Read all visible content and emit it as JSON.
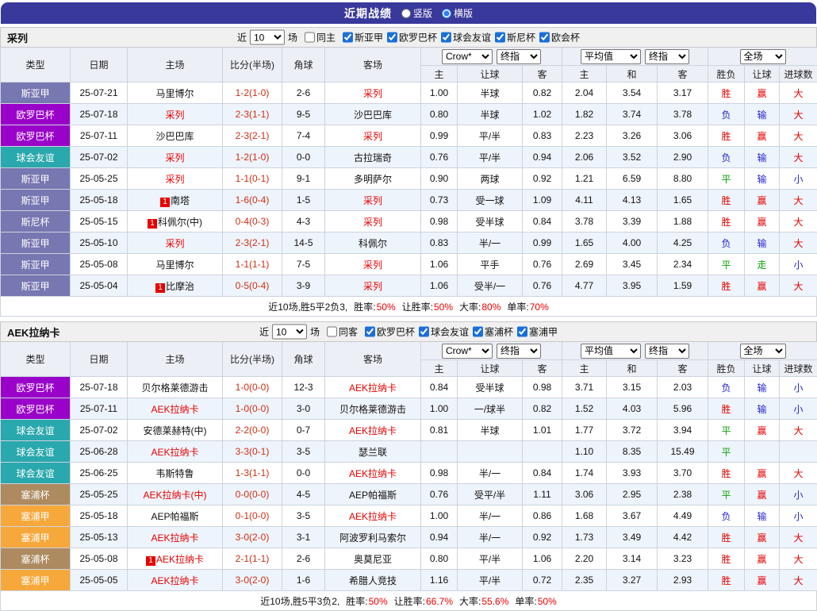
{
  "topbar": {
    "title": "近期战绩",
    "radios": [
      {
        "label": "竖版",
        "selected": false
      },
      {
        "label": "横版",
        "selected": true
      }
    ]
  },
  "league_colors": {
    "斯亚甲": "#7777b2",
    "斯尼杯": "#7777b2",
    "欧罗巴杯": "#9902c9",
    "球会友谊": "#29a8ad",
    "塞浦杯": "#ad8a60",
    "塞浦甲": "#f7a83b"
  },
  "sections": [
    {
      "title": "采列",
      "filters": {
        "near_label": "近",
        "count": "10",
        "games_label": "场",
        "same_label": "同主",
        "same_checked": false,
        "leagues": [
          {
            "label": "斯亚甲",
            "checked": true
          },
          {
            "label": "欧罗巴杯",
            "checked": true
          },
          {
            "label": "球会友谊",
            "checked": true
          },
          {
            "label": "斯尼杯",
            "checked": true
          },
          {
            "label": "欧会杯",
            "checked": true
          }
        ]
      },
      "header": {
        "cols": [
          "类型",
          "日期",
          "主场",
          "比分(半场)",
          "角球",
          "客场"
        ],
        "sub": [
          "主",
          "让球",
          "客",
          "主",
          "和",
          "客",
          "胜负",
          "让球",
          "进球数"
        ],
        "group1_selects": [
          "Crow*",
          "终指"
        ],
        "group2_selects": [
          "平均值",
          "终指"
        ],
        "group3_select": "全场"
      },
      "rows": [
        {
          "league": "斯亚甲",
          "date": "25-07-21",
          "home": {
            "name": "马里博尔",
            "red": false,
            "badge": ""
          },
          "score": "1-2(1-0)",
          "corner": "2-6",
          "away": {
            "name": "采列",
            "red": true,
            "badge": ""
          },
          "odds": [
            "1.00",
            "半球",
            "0.82"
          ],
          "avg": [
            "2.04",
            "3.54",
            "3.17"
          ],
          "results": [
            {
              "t": "胜",
              "c": "red"
            },
            {
              "t": "赢",
              "c": "red"
            },
            {
              "t": "大",
              "c": "red"
            }
          ]
        },
        {
          "league": "欧罗巴杯",
          "date": "25-07-18",
          "home": {
            "name": "采列",
            "red": true,
            "badge": ""
          },
          "score": "2-3(1-1)",
          "corner": "9-5",
          "away": {
            "name": "沙巴巴库",
            "red": false,
            "badge": ""
          },
          "odds": [
            "0.80",
            "半球",
            "1.02"
          ],
          "avg": [
            "1.82",
            "3.74",
            "3.78"
          ],
          "results": [
            {
              "t": "负",
              "c": "blue"
            },
            {
              "t": "输",
              "c": "blue"
            },
            {
              "t": "大",
              "c": "red"
            }
          ]
        },
        {
          "league": "欧罗巴杯",
          "date": "25-07-11",
          "home": {
            "name": "沙巴巴库",
            "red": false,
            "badge": ""
          },
          "score": "2-3(2-1)",
          "corner": "7-4",
          "away": {
            "name": "采列",
            "red": true,
            "badge": ""
          },
          "odds": [
            "0.99",
            "平/半",
            "0.83"
          ],
          "avg": [
            "2.23",
            "3.26",
            "3.06"
          ],
          "results": [
            {
              "t": "胜",
              "c": "red"
            },
            {
              "t": "赢",
              "c": "red"
            },
            {
              "t": "大",
              "c": "red"
            }
          ]
        },
        {
          "league": "球会友谊",
          "date": "25-07-02",
          "home": {
            "name": "采列",
            "red": true,
            "badge": ""
          },
          "score": "1-2(1-0)",
          "corner": "0-0",
          "away": {
            "name": "古拉瑞奇",
            "red": false,
            "badge": ""
          },
          "odds": [
            "0.76",
            "平/半",
            "0.94"
          ],
          "avg": [
            "2.06",
            "3.52",
            "2.90"
          ],
          "results": [
            {
              "t": "负",
              "c": "blue"
            },
            {
              "t": "输",
              "c": "blue"
            },
            {
              "t": "大",
              "c": "red"
            }
          ]
        },
        {
          "league": "斯亚甲",
          "date": "25-05-25",
          "home": {
            "name": "采列",
            "red": true,
            "badge": ""
          },
          "score": "1-1(0-1)",
          "corner": "9-1",
          "away": {
            "name": "多明萨尔",
            "red": false,
            "badge": ""
          },
          "odds": [
            "0.90",
            "两球",
            "0.92"
          ],
          "avg": [
            "1.21",
            "6.59",
            "8.80"
          ],
          "results": [
            {
              "t": "平",
              "c": "green"
            },
            {
              "t": "输",
              "c": "blue"
            },
            {
              "t": "小",
              "c": "blue"
            }
          ]
        },
        {
          "league": "斯亚甲",
          "date": "25-05-18",
          "home": {
            "name": "南塔",
            "red": false,
            "badge": "1"
          },
          "score": "1-6(0-4)",
          "corner": "1-5",
          "away": {
            "name": "采列",
            "red": true,
            "badge": ""
          },
          "odds": [
            "0.73",
            "受一球",
            "1.09"
          ],
          "avg": [
            "4.11",
            "4.13",
            "1.65"
          ],
          "results": [
            {
              "t": "胜",
              "c": "red"
            },
            {
              "t": "赢",
              "c": "red"
            },
            {
              "t": "大",
              "c": "red"
            }
          ]
        },
        {
          "league": "斯尼杯",
          "date": "25-05-15",
          "home": {
            "name": "科佩尔(中)",
            "red": false,
            "badge": "1"
          },
          "score": "0-4(0-3)",
          "corner": "4-3",
          "away": {
            "name": "采列",
            "red": true,
            "badge": ""
          },
          "odds": [
            "0.98",
            "受半球",
            "0.84"
          ],
          "avg": [
            "3.78",
            "3.39",
            "1.88"
          ],
          "results": [
            {
              "t": "胜",
              "c": "red"
            },
            {
              "t": "赢",
              "c": "red"
            },
            {
              "t": "大",
              "c": "red"
            }
          ]
        },
        {
          "league": "斯亚甲",
          "date": "25-05-10",
          "home": {
            "name": "采列",
            "red": true,
            "badge": ""
          },
          "score": "2-3(2-1)",
          "corner": "14-5",
          "away": {
            "name": "科佩尔",
            "red": false,
            "badge": ""
          },
          "odds": [
            "0.83",
            "半/一",
            "0.99"
          ],
          "avg": [
            "1.65",
            "4.00",
            "4.25"
          ],
          "results": [
            {
              "t": "负",
              "c": "blue"
            },
            {
              "t": "输",
              "c": "blue"
            },
            {
              "t": "大",
              "c": "red"
            }
          ]
        },
        {
          "league": "斯亚甲",
          "date": "25-05-08",
          "home": {
            "name": "马里博尔",
            "red": false,
            "badge": ""
          },
          "score": "1-1(1-1)",
          "corner": "7-5",
          "away": {
            "name": "采列",
            "red": true,
            "badge": ""
          },
          "odds": [
            "1.06",
            "平手",
            "0.76"
          ],
          "avg": [
            "2.69",
            "3.45",
            "2.34"
          ],
          "results": [
            {
              "t": "平",
              "c": "green"
            },
            {
              "t": "走",
              "c": "green"
            },
            {
              "t": "小",
              "c": "blue"
            }
          ]
        },
        {
          "league": "斯亚甲",
          "date": "25-05-04",
          "home": {
            "name": "比摩治",
            "red": false,
            "badge": "1"
          },
          "score": "0-5(0-4)",
          "corner": "3-9",
          "away": {
            "name": "采列",
            "red": true,
            "badge": ""
          },
          "odds": [
            "1.06",
            "受半/一",
            "0.76"
          ],
          "avg": [
            "4.77",
            "3.95",
            "1.59"
          ],
          "results": [
            {
              "t": "胜",
              "c": "red"
            },
            {
              "t": "赢",
              "c": "red"
            },
            {
              "t": "大",
              "c": "red"
            }
          ]
        }
      ],
      "summary": {
        "prefix": "近10场,胜5平2负3,",
        "stats": [
          {
            "label": "胜率:",
            "value": "50%"
          },
          {
            "label": "让胜率:",
            "value": "50%"
          },
          {
            "label": "大率:",
            "value": "80%"
          },
          {
            "label": "单率:",
            "value": "70%"
          }
        ]
      }
    },
    {
      "title": "AEK拉纳卡",
      "filters": {
        "near_label": "近",
        "count": "10",
        "games_label": "场",
        "same_label": "同客",
        "same_checked": false,
        "leagues": [
          {
            "label": "欧罗巴杯",
            "checked": true
          },
          {
            "label": "球会友谊",
            "checked": true
          },
          {
            "label": "塞浦杯",
            "checked": true
          },
          {
            "label": "塞浦甲",
            "checked": true
          }
        ]
      },
      "header": {
        "cols": [
          "类型",
          "日期",
          "主场",
          "比分(半场)",
          "角球",
          "客场"
        ],
        "sub": [
          "主",
          "让球",
          "客",
          "主",
          "和",
          "客",
          "胜负",
          "让球",
          "进球数"
        ],
        "group1_selects": [
          "Crow*",
          "终指"
        ],
        "group2_selects": [
          "平均值",
          "终指"
        ],
        "group3_select": "全场"
      },
      "rows": [
        {
          "league": "欧罗巴杯",
          "date": "25-07-18",
          "home": {
            "name": "贝尔格莱德游击",
            "red": false,
            "badge": ""
          },
          "score": "1-0(0-0)",
          "corner": "12-3",
          "away": {
            "name": "AEK拉纳卡",
            "red": true,
            "badge": ""
          },
          "odds": [
            "0.84",
            "受半球",
            "0.98"
          ],
          "avg": [
            "3.71",
            "3.15",
            "2.03"
          ],
          "results": [
            {
              "t": "负",
              "c": "blue"
            },
            {
              "t": "输",
              "c": "blue"
            },
            {
              "t": "小",
              "c": "blue"
            }
          ]
        },
        {
          "league": "欧罗巴杯",
          "date": "25-07-11",
          "home": {
            "name": "AEK拉纳卡",
            "red": true,
            "badge": ""
          },
          "score": "1-0(0-0)",
          "corner": "3-0",
          "away": {
            "name": "贝尔格莱德游击",
            "red": false,
            "badge": ""
          },
          "odds": [
            "1.00",
            "一/球半",
            "0.82"
          ],
          "avg": [
            "1.52",
            "4.03",
            "5.96"
          ],
          "results": [
            {
              "t": "胜",
              "c": "red"
            },
            {
              "t": "输",
              "c": "blue"
            },
            {
              "t": "小",
              "c": "blue"
            }
          ]
        },
        {
          "league": "球会友谊",
          "date": "25-07-02",
          "home": {
            "name": "安德莱赫特(中)",
            "red": false,
            "badge": ""
          },
          "score": "2-2(0-0)",
          "corner": "0-7",
          "away": {
            "name": "AEK拉纳卡",
            "red": true,
            "badge": ""
          },
          "odds": [
            "0.81",
            "半球",
            "1.01"
          ],
          "avg": [
            "1.77",
            "3.72",
            "3.94"
          ],
          "results": [
            {
              "t": "平",
              "c": "green"
            },
            {
              "t": "赢",
              "c": "red"
            },
            {
              "t": "大",
              "c": "red"
            }
          ]
        },
        {
          "league": "球会友谊",
          "date": "25-06-28",
          "home": {
            "name": "AEK拉纳卡",
            "red": true,
            "badge": ""
          },
          "score": "3-3(0-1)",
          "corner": "3-5",
          "away": {
            "name": "瑟兰联",
            "red": false,
            "badge": ""
          },
          "odds": [
            "",
            "",
            ""
          ],
          "avg": [
            "1.10",
            "8.35",
            "15.49"
          ],
          "results": [
            {
              "t": "平",
              "c": "green"
            },
            {
              "t": "",
              "c": "none"
            },
            {
              "t": "",
              "c": "none"
            }
          ]
        },
        {
          "league": "球会友谊",
          "date": "25-06-25",
          "home": {
            "name": "韦斯特鲁",
            "red": false,
            "badge": ""
          },
          "score": "1-3(1-1)",
          "corner": "0-0",
          "away": {
            "name": "AEK拉纳卡",
            "red": true,
            "badge": ""
          },
          "odds": [
            "0.98",
            "半/一",
            "0.84"
          ],
          "avg": [
            "1.74",
            "3.93",
            "3.70"
          ],
          "results": [
            {
              "t": "胜",
              "c": "red"
            },
            {
              "t": "赢",
              "c": "red"
            },
            {
              "t": "大",
              "c": "red"
            }
          ]
        },
        {
          "league": "塞浦杯",
          "date": "25-05-25",
          "home": {
            "name": "AEK拉纳卡(中)",
            "red": true,
            "badge": ""
          },
          "score": "0-0(0-0)",
          "corner": "4-5",
          "away": {
            "name": "AEP帕福斯",
            "red": false,
            "badge": ""
          },
          "odds": [
            "0.76",
            "受平/半",
            "1.11"
          ],
          "avg": [
            "3.06",
            "2.95",
            "2.38"
          ],
          "results": [
            {
              "t": "平",
              "c": "green"
            },
            {
              "t": "赢",
              "c": "red"
            },
            {
              "t": "小",
              "c": "blue"
            }
          ]
        },
        {
          "league": "塞浦甲",
          "date": "25-05-18",
          "home": {
            "name": "AEP帕福斯",
            "red": false,
            "badge": ""
          },
          "score": "0-1(0-0)",
          "corner": "3-5",
          "away": {
            "name": "AEK拉纳卡",
            "red": true,
            "badge": ""
          },
          "odds": [
            "1.00",
            "半/一",
            "0.86"
          ],
          "avg": [
            "1.68",
            "3.67",
            "4.49"
          ],
          "results": [
            {
              "t": "负",
              "c": "blue"
            },
            {
              "t": "输",
              "c": "blue"
            },
            {
              "t": "小",
              "c": "blue"
            }
          ]
        },
        {
          "league": "塞浦甲",
          "date": "25-05-13",
          "home": {
            "name": "AEK拉纳卡",
            "red": true,
            "badge": ""
          },
          "score": "3-0(2-0)",
          "corner": "3-1",
          "away": {
            "name": "阿波罗利马索尔",
            "red": false,
            "badge": ""
          },
          "odds": [
            "0.94",
            "半/一",
            "0.92"
          ],
          "avg": [
            "1.73",
            "3.49",
            "4.42"
          ],
          "results": [
            {
              "t": "胜",
              "c": "red"
            },
            {
              "t": "赢",
              "c": "red"
            },
            {
              "t": "大",
              "c": "red"
            }
          ]
        },
        {
          "league": "塞浦杯",
          "date": "25-05-08",
          "home": {
            "name": "AEK拉纳卡",
            "red": true,
            "badge": "1"
          },
          "score": "2-1(1-1)",
          "corner": "2-6",
          "away": {
            "name": "奥莫尼亚",
            "red": false,
            "badge": ""
          },
          "odds": [
            "0.80",
            "平/半",
            "1.06"
          ],
          "avg": [
            "2.20",
            "3.14",
            "3.23"
          ],
          "results": [
            {
              "t": "胜",
              "c": "red"
            },
            {
              "t": "赢",
              "c": "red"
            },
            {
              "t": "大",
              "c": "red"
            }
          ]
        },
        {
          "league": "塞浦甲",
          "date": "25-05-05",
          "home": {
            "name": "AEK拉纳卡",
            "red": true,
            "badge": ""
          },
          "score": "3-0(2-0)",
          "corner": "1-6",
          "away": {
            "name": "希腊人竞技",
            "red": false,
            "badge": ""
          },
          "odds": [
            "1.16",
            "平/半",
            "0.72"
          ],
          "avg": [
            "2.35",
            "3.27",
            "2.93"
          ],
          "results": [
            {
              "t": "胜",
              "c": "red"
            },
            {
              "t": "赢",
              "c": "red"
            },
            {
              "t": "大",
              "c": "red"
            }
          ]
        }
      ],
      "summary": {
        "prefix": "近10场,胜5平3负2,",
        "stats": [
          {
            "label": "胜率:",
            "value": "50%"
          },
          {
            "label": "让胜率:",
            "value": "66.7%"
          },
          {
            "label": "大率:",
            "value": "55.6%"
          },
          {
            "label": "单率:",
            "value": "50%"
          }
        ]
      }
    }
  ]
}
